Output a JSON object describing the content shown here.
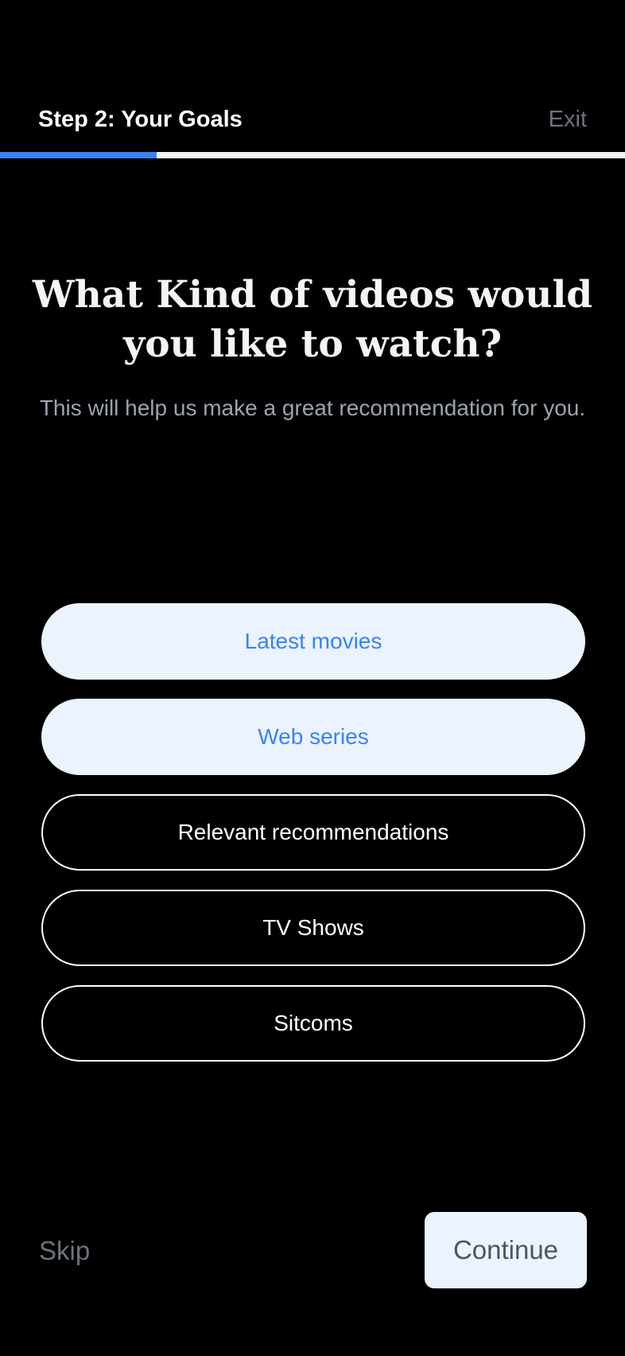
{
  "header": {
    "step_title": "Step 2: Your Goals",
    "exit_label": "Exit",
    "progress_fraction": 0.25
  },
  "hero": {
    "title": "What Kind of videos would you like to watch?",
    "subtitle": "This will help us make a great recommendation for you."
  },
  "options": [
    {
      "label": "Latest movies",
      "selected": true
    },
    {
      "label": "Web series",
      "selected": true
    },
    {
      "label": "Relevant recommendations",
      "selected": false
    },
    {
      "label": "TV Shows",
      "selected": false
    },
    {
      "label": "Sitcoms",
      "selected": false
    }
  ],
  "footer": {
    "skip_label": "Skip",
    "continue_label": "Continue"
  },
  "colors": {
    "background": "#000000",
    "accent": "#3b82f6",
    "selected_bg": "#ebf3ff",
    "muted_text": "#6b7280"
  }
}
